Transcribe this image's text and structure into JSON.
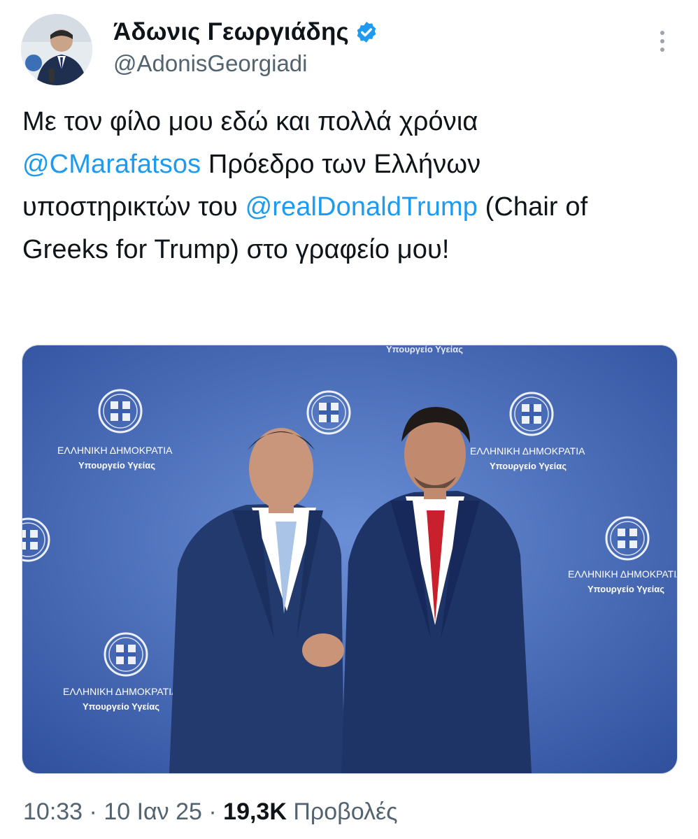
{
  "author": {
    "display_name": "Άδωνις Γεωργιάδης",
    "handle": "@AdonisGeorgiadi",
    "verified": true,
    "accent_color": "#1d9bf0"
  },
  "tweet": {
    "segments": [
      {
        "text": "Με τον φίλο μου εδώ και πολλά χρόνια ",
        "mention": false
      },
      {
        "text": "@CMarafatsos",
        "mention": true
      },
      {
        "text": " Πρόεδρο των Ελλήνων υποστηρικτών του ",
        "mention": false
      },
      {
        "text": "@realDonaldTrump",
        "mention": true
      },
      {
        "text": " (Chair of Greeks for Trump) στο γραφείο μου!",
        "mention": false
      }
    ]
  },
  "media": {
    "backdrop_color": "#3b5fae",
    "backdrop_repeated_text": {
      "line1": "ΕΛΛΗΝΙΚΗ ΔΗΜΟΚΡΑΤΙΑ",
      "line2": "Υπουργείο Υγείας"
    }
  },
  "meta": {
    "time": "10:33",
    "separator": " · ",
    "date": "10 Ιαν 25",
    "views_count": "19,3K",
    "views_label": "Προβολές"
  },
  "icons": {
    "verified": "verified-badge-icon",
    "more": "more-vertical-icon"
  }
}
